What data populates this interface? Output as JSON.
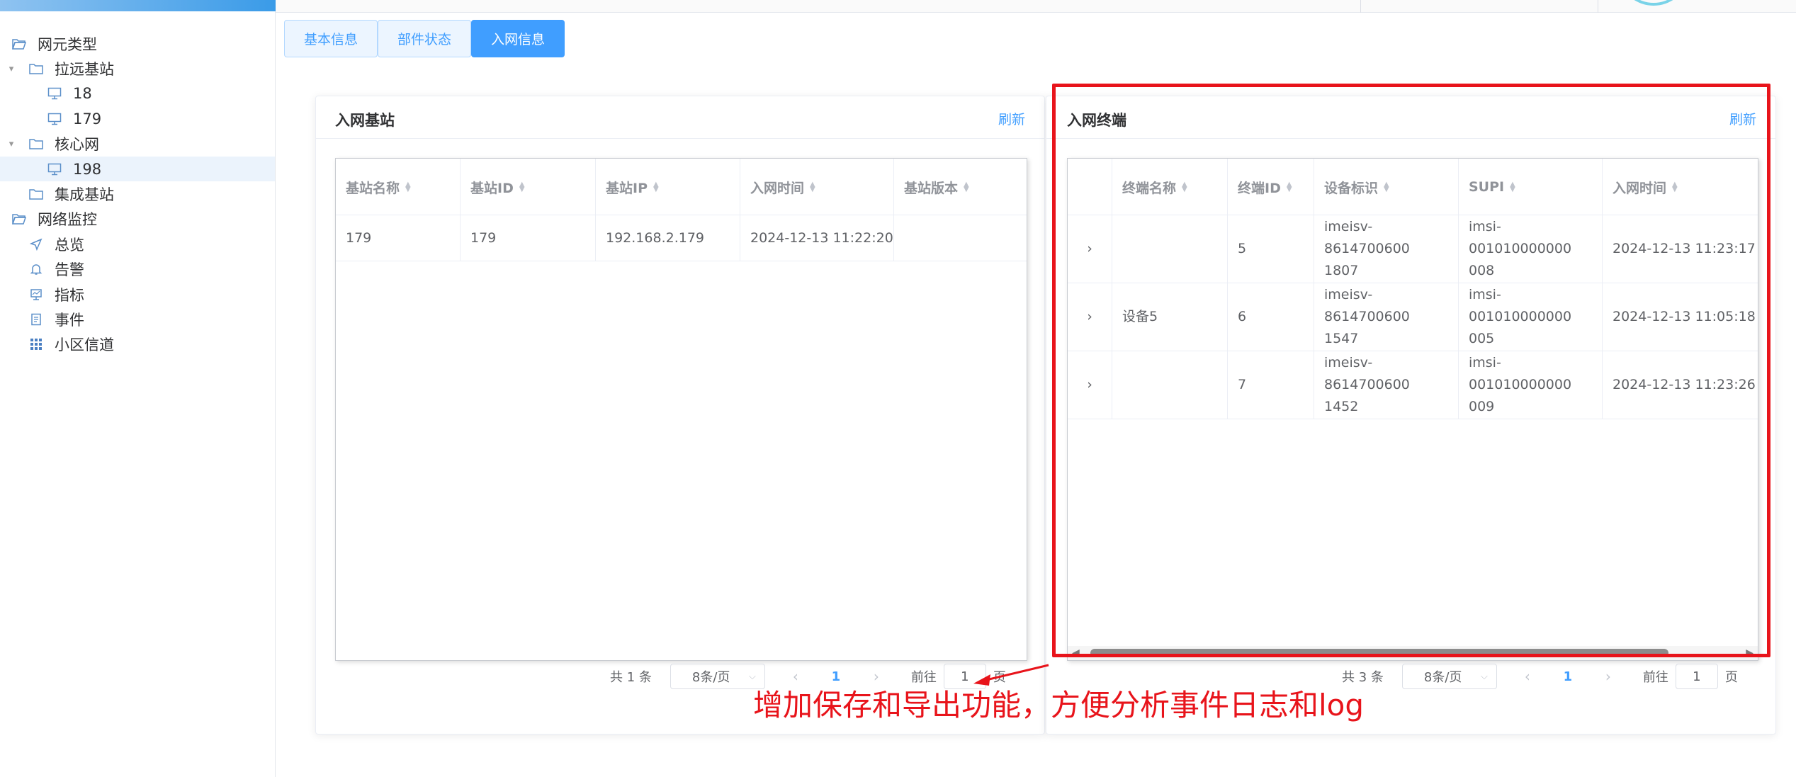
{
  "sidebar": {
    "items": [
      {
        "label": "网元类型",
        "icon": "folder-open-icon",
        "level": 0
      },
      {
        "label": "拉远基站",
        "icon": "folder-icon",
        "level": 1,
        "expandable": true
      },
      {
        "label": "18",
        "icon": "monitor-icon",
        "level": 2
      },
      {
        "label": "179",
        "icon": "monitor-icon",
        "level": 2
      },
      {
        "label": "核心网",
        "icon": "folder-icon",
        "level": 1,
        "expandable": true
      },
      {
        "label": "198",
        "icon": "monitor-icon",
        "level": 2,
        "selected": true
      },
      {
        "label": "集成基站",
        "icon": "folder-icon",
        "level": 1
      },
      {
        "label": "网络监控",
        "icon": "folder-open-icon",
        "level": 0
      },
      {
        "label": "总览",
        "icon": "navigation-icon",
        "level": 1
      },
      {
        "label": "告警",
        "icon": "bell-icon",
        "level": 1
      },
      {
        "label": "指标",
        "icon": "chart-board-icon",
        "level": 1
      },
      {
        "label": "事件",
        "icon": "document-icon",
        "level": 1
      },
      {
        "label": "小区信道",
        "icon": "grid-icon",
        "level": 1
      }
    ]
  },
  "tabs": [
    {
      "label": "基本信息",
      "active": false
    },
    {
      "label": "部件状态",
      "active": false
    },
    {
      "label": "入网信息",
      "active": true
    }
  ],
  "left_panel": {
    "title": "入网基站",
    "refresh": "刷新",
    "columns": [
      "基站名称",
      "基站ID",
      "基站IP",
      "入网时间",
      "基站版本"
    ],
    "rows": [
      [
        "179",
        "179",
        "192.168.2.179",
        "2024-12-13 11:22:20",
        ""
      ]
    ],
    "pager": {
      "total": "共 1 条",
      "page_size": "8条/页",
      "page": "1",
      "goto_prefix": "前往",
      "goto_value": "1",
      "goto_suffix": "页"
    }
  },
  "right_panel": {
    "title": "入网终端",
    "refresh": "刷新",
    "columns": [
      "",
      "终端名称",
      "终端ID",
      "设备标识",
      "SUPI",
      "入网时间"
    ],
    "rows": [
      [
        "",
        "",
        "5",
        "imeisv-8614700600\n1807",
        "imsi-001010000000\n008",
        "2024-12-13 11:23:17"
      ],
      [
        "",
        "设备5",
        "6",
        "imeisv-8614700600\n1547",
        "imsi-001010000000\n005",
        "2024-12-13 11:05:18"
      ],
      [
        "",
        "",
        "7",
        "imeisv-8614700600\n1452",
        "imsi-001010000000\n009",
        "2024-12-13 11:23:26"
      ]
    ],
    "pager": {
      "total": "共 3 条",
      "page_size": "8条/页",
      "page": "1",
      "goto_prefix": "前往",
      "goto_value": "1",
      "goto_suffix": "页"
    }
  },
  "annotation": {
    "text": "增加保存和导出功能，方便分析事件日志和log",
    "color": "#e8141b"
  },
  "colors": {
    "accent": "#409eff",
    "selected_bg": "#ebf3fc",
    "annotation": "#e8141b"
  }
}
